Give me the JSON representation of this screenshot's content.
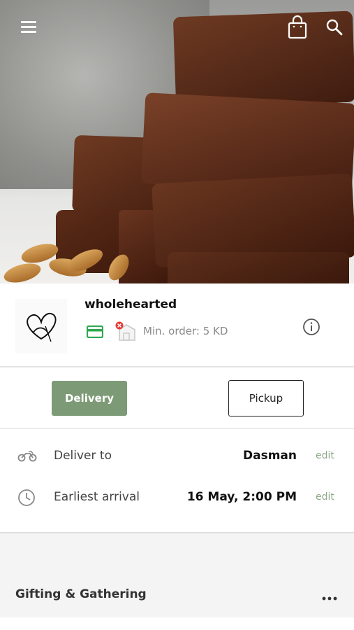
{
  "header": {
    "icons": [
      "menu-icon",
      "shopping-bag-icon",
      "search-icon"
    ]
  },
  "store": {
    "name": "wholehearted",
    "min_order": "Min. order: 5 KD",
    "icons": [
      "card-icon",
      "store-closed-icon",
      "info-icon"
    ]
  },
  "mode": {
    "delivery_label": "Delivery",
    "pickup_label": "Pickup",
    "active": "Delivery"
  },
  "delivery": {
    "deliver_to_label": "Deliver to",
    "deliver_to_value": "Dasman",
    "arrival_label": "Earliest arrival",
    "arrival_value": "16 May, 2:00 PM",
    "edit_label": "edit"
  },
  "category": {
    "title": "Gifting & Gathering"
  },
  "colors": {
    "accent": "#7d9a77",
    "edit_link": "#8fa88a",
    "card_icon": "#2fa84f"
  }
}
